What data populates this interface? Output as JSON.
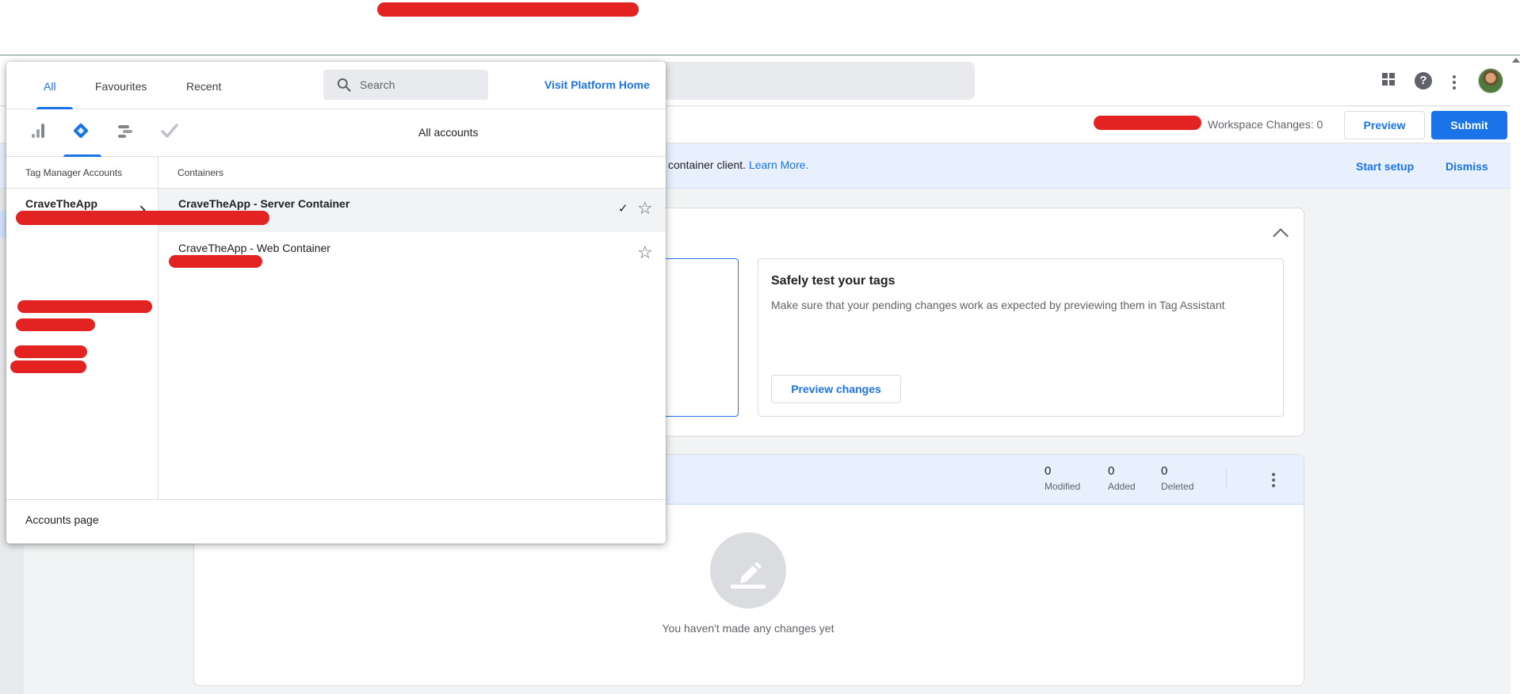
{
  "header": {
    "apps_icon": "apps-grid-icon",
    "help_icon": "help-icon",
    "more_icon": "more-vert-icon",
    "avatar": "user-avatar"
  },
  "toolbar": {
    "workspace_changes": "Workspace Changes: 0",
    "preview_label": "Preview",
    "submit_label": "Submit"
  },
  "banner": {
    "text": "container client.",
    "link": "Learn More.",
    "start_setup": "Start setup",
    "dismiss": "Dismiss"
  },
  "test_card": {
    "title": "Safely test your tags",
    "description": "Make sure that your pending changes work as expected by previewing them in Tag Assistant",
    "button": "Preview changes"
  },
  "workspace_changes": {
    "stats": [
      {
        "value": "0",
        "label": "Modified"
      },
      {
        "value": "0",
        "label": "Added"
      },
      {
        "value": "0",
        "label": "Deleted"
      }
    ],
    "empty_text": "You haven't made any changes yet"
  },
  "picker": {
    "tabs": [
      {
        "label": "All",
        "active": true
      },
      {
        "label": "Favourites",
        "active": false
      },
      {
        "label": "Recent",
        "active": false
      }
    ],
    "search_placeholder": "Search",
    "visit_platform_home": "Visit Platform Home",
    "products": [
      "analytics-icon",
      "tag-manager-icon",
      "optimize-icon",
      "surveys-icon"
    ],
    "all_accounts": "All accounts",
    "accounts_header": "Tag Manager Accounts",
    "containers_header": "Containers",
    "accounts": [
      {
        "name": "CraveTheApp",
        "selected": true
      }
    ],
    "containers": [
      {
        "name": "CraveTheApp - Server Container",
        "current": true
      },
      {
        "name": "CraveTheApp - Web Container",
        "current": false
      }
    ],
    "footer_link": "Accounts page"
  },
  "colors": {
    "accent": "#1a73e8",
    "redaction": "#e32222",
    "banner_bg": "#e8f0fe"
  }
}
